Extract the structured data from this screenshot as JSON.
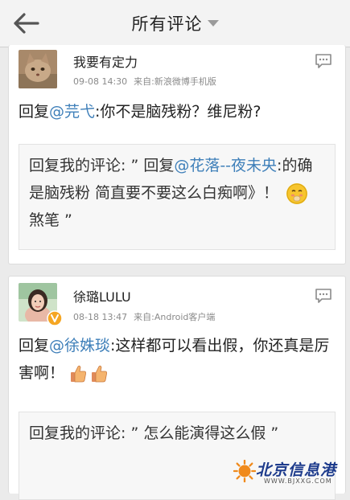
{
  "header": {
    "title": "所有评论"
  },
  "comments": [
    {
      "user": "我要有定力",
      "date": "09-08 14:30",
      "source": "来自:新浪微博手机版",
      "reply_prefix": "回复",
      "mention": "@芫弋",
      "text": ":你不是脑残粉？维尼粉?",
      "quote": {
        "prefix": "回复我的评论: ” 回复",
        "mention": "@花落--夜未央",
        "text": ":的确是脑残粉 简直要不要这么白痴啊》！",
        "suffix": "煞笔 ”"
      }
    },
    {
      "user": "徐璐LULU",
      "date": "08-18 13:47",
      "source": "来自:Android客户端",
      "reply_prefix": "回复",
      "mention": "@徐姝琰",
      "text": ":这样都可以看出假，你还真是厉害啊！",
      "quote": {
        "text": "回复我的评论: ” 怎么能演得这么假 ”"
      }
    }
  ],
  "watermark": {
    "name": "北京信息港",
    "url": "WWW.BJXXG.COM"
  }
}
